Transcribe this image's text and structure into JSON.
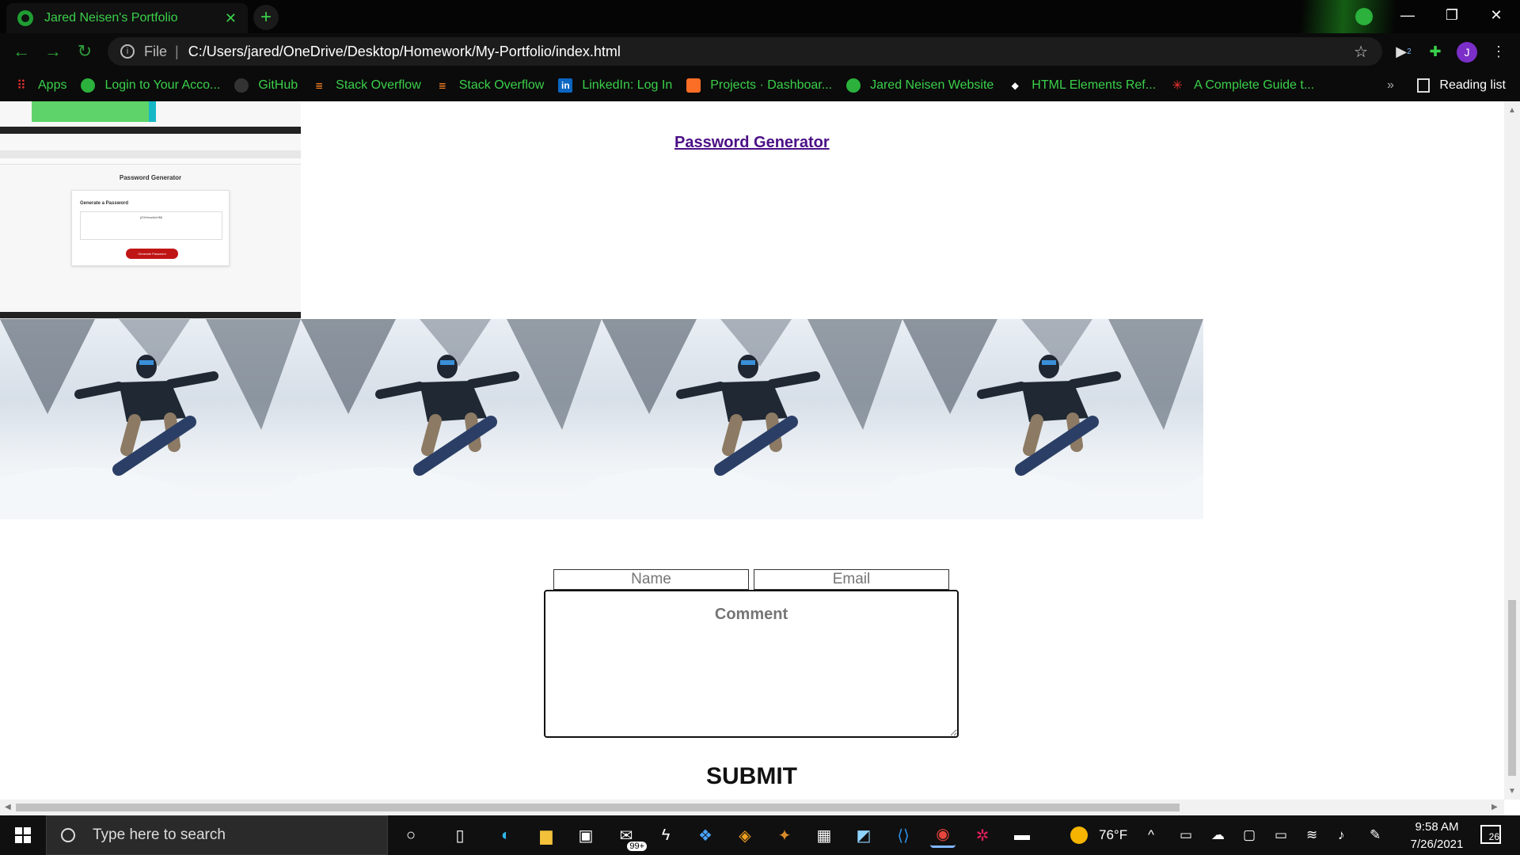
{
  "browser": {
    "tab_title": "Jared Neisen's Portfolio",
    "tab_close": "✕",
    "new_tab": "+",
    "url_scheme": "File",
    "url_separator": "|",
    "url": "C:/Users/jared/OneDrive/Desktop/Homework/My-Portfolio/index.html",
    "profile_initial": "J",
    "extension_badge": "2",
    "reading_list": "Reading list",
    "bookmarks_overflow": "»",
    "bookmarks": [
      {
        "label": "Apps",
        "icon": "apps-grid-icon"
      },
      {
        "label": "Login to Your Acco...",
        "icon": "globe-icon"
      },
      {
        "label": "GitHub",
        "icon": "github-icon"
      },
      {
        "label": "Stack Overflow",
        "icon": "stackoverflow-icon"
      },
      {
        "label": "Stack Overflow",
        "icon": "stackoverflow-icon"
      },
      {
        "label": "LinkedIn: Log In",
        "icon": "linkedin-icon"
      },
      {
        "label": "Projects · Dashboar...",
        "icon": "gitlab-icon"
      },
      {
        "label": "Jared Neisen Website",
        "icon": "globe-icon"
      },
      {
        "label": "HTML Elements Ref...",
        "icon": "devdocs-icon"
      },
      {
        "label": "A Complete Guide t...",
        "icon": "asterisk-icon"
      }
    ]
  },
  "page": {
    "thumbnail": {
      "title": "Password Generator",
      "card_heading": "Generate a Password",
      "password_value": "j2%%vw4#e*$8",
      "button_label": "Generate Password"
    },
    "project_link": "Password Generator",
    "form": {
      "name_placeholder": "Name",
      "email_placeholder": "Email",
      "comment_placeholder": "Comment",
      "submit_label": "SUBMIT"
    }
  },
  "taskbar": {
    "search_placeholder": "Type here to search",
    "store_badge": "99+",
    "weather": "76°F",
    "time": "9:58 AM",
    "date": "7/26/2021",
    "notification_count": "26"
  },
  "colors": {
    "accent_green": "#3ad04a",
    "link_purple": "#4b0f86",
    "chrome_dark": "#0b0b0b"
  }
}
